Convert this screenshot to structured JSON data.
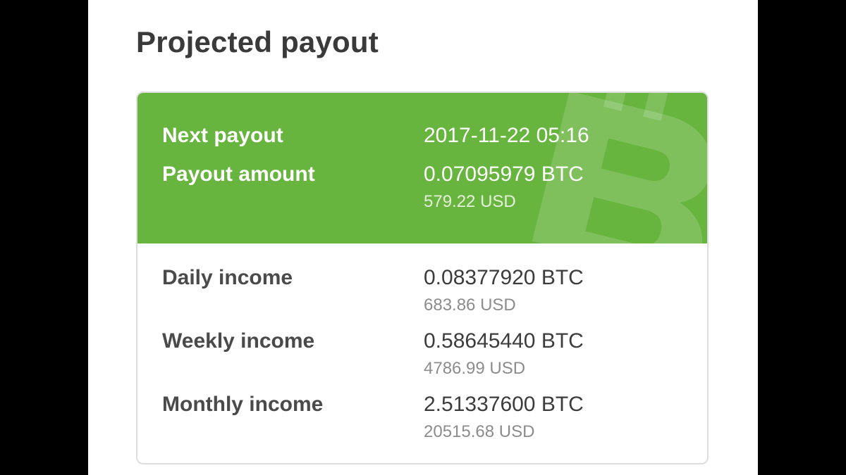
{
  "page_title": "Projected payout",
  "header_color": "#67b43e",
  "logo_icon": "bitcoin-cash-icon",
  "payout": {
    "next_label": "Next payout",
    "next_value": "2017-11-22 05:16",
    "amount_label": "Payout amount",
    "amount_btc": "0.07095979 BTC",
    "amount_usd": "579.22 USD"
  },
  "income": [
    {
      "label": "Daily income",
      "btc": "0.08377920 BTC",
      "usd": "683.86 USD"
    },
    {
      "label": "Weekly income",
      "btc": "0.58645440 BTC",
      "usd": "4786.99 USD"
    },
    {
      "label": "Monthly income",
      "btc": "2.51337600 BTC",
      "usd": "20515.68 USD"
    }
  ]
}
